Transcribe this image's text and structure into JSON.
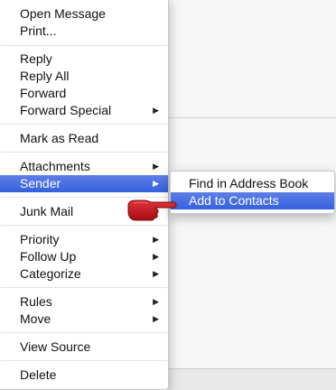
{
  "context_menu": {
    "items": [
      {
        "label": "Open Message",
        "has_submenu": false
      },
      {
        "label": "Print...",
        "has_submenu": false
      },
      {
        "label": "Reply",
        "has_submenu": false
      },
      {
        "label": "Reply All",
        "has_submenu": false
      },
      {
        "label": "Forward",
        "has_submenu": false
      },
      {
        "label": "Forward Special",
        "has_submenu": true
      },
      {
        "label": "Mark as Read",
        "has_submenu": false
      },
      {
        "label": "Attachments",
        "has_submenu": true
      },
      {
        "label": "Sender",
        "has_submenu": true,
        "highlighted": true
      },
      {
        "label": "Junk Mail",
        "has_submenu": false
      },
      {
        "label": "Priority",
        "has_submenu": true
      },
      {
        "label": "Follow Up",
        "has_submenu": true
      },
      {
        "label": "Categorize",
        "has_submenu": true
      },
      {
        "label": "Rules",
        "has_submenu": true
      },
      {
        "label": "Move",
        "has_submenu": true
      },
      {
        "label": "View Source",
        "has_submenu": false
      },
      {
        "label": "Delete",
        "has_submenu": false
      }
    ],
    "arrow_glyph": "▶"
  },
  "sender_submenu": {
    "items": [
      {
        "label": "Find in Address Book"
      },
      {
        "label": "Add to Contacts",
        "highlighted": true
      }
    ]
  },
  "colors": {
    "highlight": "#3a66de",
    "pointer": "#c8141e"
  },
  "icons": {
    "pointer": "pointing-hand-icon"
  }
}
